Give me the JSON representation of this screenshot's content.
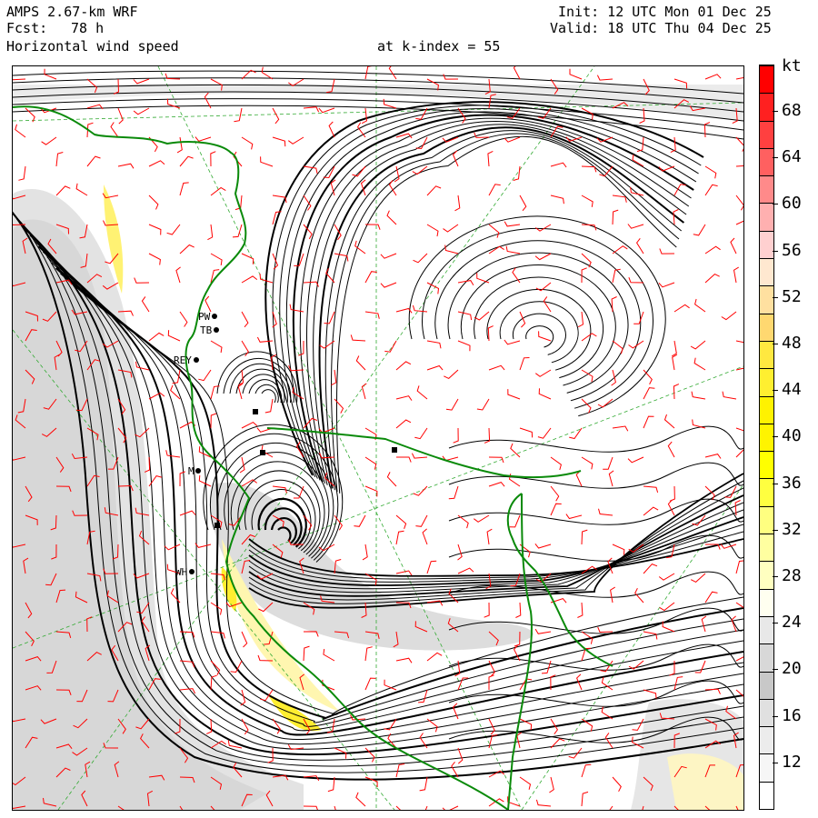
{
  "header": {
    "model": "AMPS 2.67-km WRF",
    "init": "Init: 12 UTC Mon 01 Dec 25",
    "fcst_label": "Fcst:",
    "fcst_value": "78 h",
    "valid": "Valid: 18 UTC Thu 04 Dec 25",
    "field": "Horizontal wind speed",
    "level": "at k-index = 55"
  },
  "colorbar": {
    "unit": "kt",
    "labels": [
      "68",
      "64",
      "60",
      "56",
      "52",
      "48",
      "44",
      "40",
      "36",
      "32",
      "28",
      "24",
      "20",
      "16",
      "12"
    ],
    "colors": [
      "#ff0000",
      "#ff2020",
      "#ff4040",
      "#ff6060",
      "#ff8a8a",
      "#ffb0b0",
      "#ffd0d0",
      "#ffe8d0",
      "#ffe0a0",
      "#ffd870",
      "#ffe840",
      "#ffef30",
      "#fff200",
      "#fff400",
      "#ffff00",
      "#ffff40",
      "#ffff80",
      "#ffffa0",
      "#ffffc0",
      "#fffff0",
      "#e8e8e8",
      "#d8d8d8",
      "#c8c8c8",
      "#e0e0e0",
      "#ececec",
      "#f6f6f6",
      "#ffffff"
    ]
  },
  "stations": [
    "PW",
    "TB",
    "REY",
    "M",
    "WH"
  ],
  "colors": {
    "coastline": "#0a8a0a",
    "barb": "#ff0000",
    "gridline": "#33aa33",
    "streamline": "#000000"
  }
}
